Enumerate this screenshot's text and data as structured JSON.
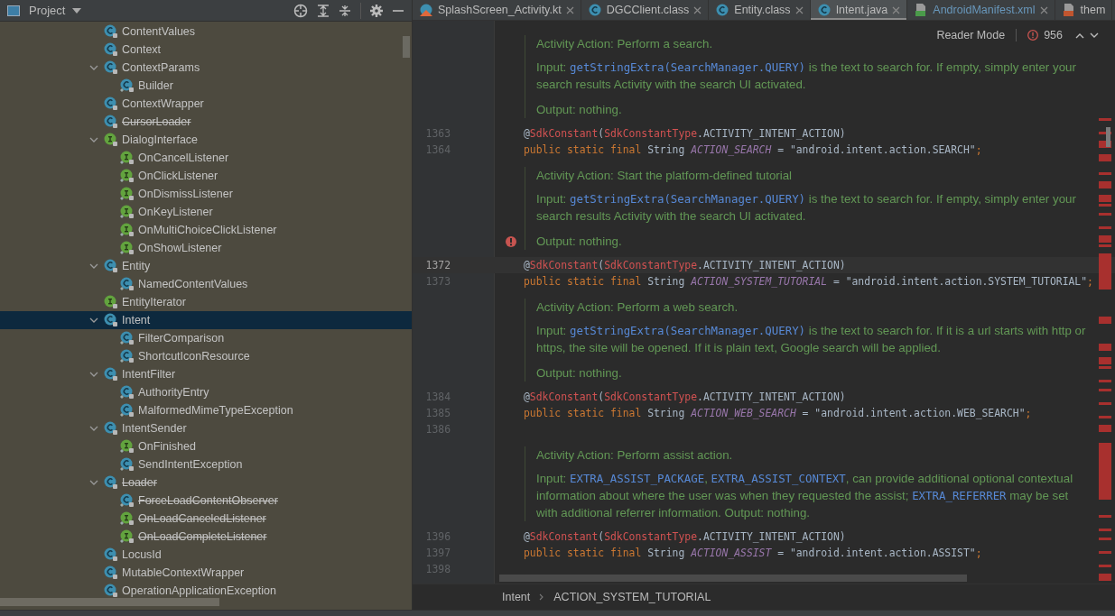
{
  "project_panel": {
    "title": "Project",
    "tree": [
      {
        "label": "ContentValues",
        "kind": "class",
        "deprecated": false,
        "selected": false,
        "expanded": false
      },
      {
        "label": "Context",
        "kind": "class",
        "deprecated": false,
        "selected": false,
        "expanded": false
      },
      {
        "label": "ContextParams",
        "kind": "class",
        "deprecated": false,
        "selected": false,
        "expanded": true,
        "children": [
          {
            "label": "Builder",
            "kind": "class",
            "deprecated": false,
            "selected": false,
            "expanded": false
          }
        ]
      },
      {
        "label": "ContextWrapper",
        "kind": "class",
        "deprecated": false,
        "selected": false,
        "expanded": false
      },
      {
        "label": "CursorLoader",
        "kind": "class",
        "deprecated": true,
        "selected": false,
        "expanded": false
      },
      {
        "label": "DialogInterface",
        "kind": "interface",
        "deprecated": false,
        "selected": false,
        "expanded": true,
        "children": [
          {
            "label": "OnCancelListener",
            "kind": "interface",
            "deprecated": false,
            "selected": false,
            "expanded": false
          },
          {
            "label": "OnClickListener",
            "kind": "interface",
            "deprecated": false,
            "selected": false,
            "expanded": false
          },
          {
            "label": "OnDismissListener",
            "kind": "interface",
            "deprecated": false,
            "selected": false,
            "expanded": false
          },
          {
            "label": "OnKeyListener",
            "kind": "interface",
            "deprecated": false,
            "selected": false,
            "expanded": false
          },
          {
            "label": "OnMultiChoiceClickListener",
            "kind": "interface",
            "deprecated": false,
            "selected": false,
            "expanded": false
          },
          {
            "label": "OnShowListener",
            "kind": "interface",
            "deprecated": false,
            "selected": false,
            "expanded": false
          }
        ]
      },
      {
        "label": "Entity",
        "kind": "class",
        "deprecated": false,
        "selected": false,
        "expanded": true,
        "children": [
          {
            "label": "NamedContentValues",
            "kind": "class",
            "deprecated": false,
            "selected": false,
            "expanded": false
          }
        ]
      },
      {
        "label": "EntityIterator",
        "kind": "interface",
        "deprecated": false,
        "selected": false,
        "expanded": false
      },
      {
        "label": "Intent",
        "kind": "class",
        "deprecated": false,
        "selected": true,
        "expanded": true,
        "children": [
          {
            "label": "FilterComparison",
            "kind": "class",
            "deprecated": false,
            "selected": false,
            "expanded": false
          },
          {
            "label": "ShortcutIconResource",
            "kind": "class",
            "deprecated": false,
            "selected": false,
            "expanded": false
          }
        ]
      },
      {
        "label": "IntentFilter",
        "kind": "class",
        "deprecated": false,
        "selected": false,
        "expanded": true,
        "children": [
          {
            "label": "AuthorityEntry",
            "kind": "class",
            "deprecated": false,
            "selected": false,
            "expanded": false
          },
          {
            "label": "MalformedMimeTypeException",
            "kind": "class",
            "deprecated": false,
            "selected": false,
            "expanded": false
          }
        ]
      },
      {
        "label": "IntentSender",
        "kind": "class",
        "deprecated": false,
        "selected": false,
        "expanded": true,
        "children": [
          {
            "label": "OnFinished",
            "kind": "interface",
            "deprecated": false,
            "selected": false,
            "expanded": false
          },
          {
            "label": "SendIntentException",
            "kind": "class",
            "deprecated": false,
            "selected": false,
            "expanded": false
          }
        ]
      },
      {
        "label": "Loader",
        "kind": "class",
        "deprecated": true,
        "selected": false,
        "expanded": true,
        "children": [
          {
            "label": "ForceLoadContentObserver",
            "kind": "class",
            "deprecated": true,
            "selected": false,
            "expanded": false
          },
          {
            "label": "OnLoadCanceledListener",
            "kind": "interface",
            "deprecated": true,
            "selected": false,
            "expanded": false
          },
          {
            "label": "OnLoadCompleteListener",
            "kind": "interface",
            "deprecated": true,
            "selected": false,
            "expanded": false
          }
        ]
      },
      {
        "label": "LocusId",
        "kind": "class",
        "deprecated": false,
        "selected": false,
        "expanded": false
      },
      {
        "label": "MutableContextWrapper",
        "kind": "class",
        "deprecated": false,
        "selected": false,
        "expanded": false
      },
      {
        "label": "OperationApplicationException",
        "kind": "class",
        "deprecated": false,
        "selected": false,
        "expanded": false
      }
    ]
  },
  "tabs": [
    {
      "label": "SplashScreen_Activity.kt",
      "kind": "kotlin",
      "selected": false,
      "closable": true,
      "color": "#bbbbbb"
    },
    {
      "label": "DGCClient.class",
      "kind": "class",
      "selected": false,
      "closable": true,
      "color": "#bbbbbb"
    },
    {
      "label": "Entity.class",
      "kind": "class",
      "selected": false,
      "closable": true,
      "color": "#bbbbbb"
    },
    {
      "label": "Intent.java",
      "kind": "class",
      "selected": true,
      "closable": true,
      "color": "#bbbbbb"
    },
    {
      "label": "AndroidManifest.xml",
      "kind": "manifest",
      "selected": false,
      "closable": true,
      "color": "#6897bb"
    },
    {
      "label": "them",
      "kind": "xml",
      "selected": false,
      "closable": false,
      "color": "#bbbbbb"
    }
  ],
  "reader_mode": {
    "label": "Reader Mode",
    "problems": "956"
  },
  "editor": [
    {
      "kind": "doc",
      "paragraphs": [
        [
          {
            "kind": "text",
            "text": "Activity Action: Perform a search."
          }
        ],
        [
          {
            "kind": "text",
            "text": "Input: "
          },
          {
            "kind": "link",
            "text": "getStringExtra(SearchManager.QUERY)"
          },
          {
            "kind": "text",
            "text": " is the text to search for. If empty, simply enter your search results Activity with the search UI activated."
          }
        ],
        [
          {
            "kind": "text",
            "text": "Output: nothing."
          }
        ]
      ]
    },
    {
      "kind": "code",
      "number": "1363",
      "current": false,
      "tokens": [
        {
          "kind": "plain",
          "t": "@"
        },
        {
          "kind": "annotation",
          "t": "SdkConstant"
        },
        {
          "kind": "plain",
          "t": "("
        },
        {
          "kind": "annotation",
          "t": "SdkConstantType"
        },
        {
          "kind": "plain",
          "t": ".ACTIVITY_INTENT_ACTION)"
        }
      ]
    },
    {
      "kind": "code",
      "number": "1364",
      "current": false,
      "tokens": [
        {
          "kind": "keyword",
          "t": "public static final "
        },
        {
          "kind": "plain",
          "t": "String "
        },
        {
          "kind": "field",
          "t": "ACTION_SEARCH"
        },
        {
          "kind": "plain",
          "t": " = "
        },
        {
          "kind": "string",
          "t": "\"android.intent.action.SEARCH\""
        },
        {
          "kind": "keyword",
          "t": ";"
        }
      ]
    },
    {
      "kind": "doc",
      "has_error": true,
      "paragraphs": [
        [
          {
            "kind": "text",
            "text": "Activity Action: Start the platform-defined tutorial"
          }
        ],
        [
          {
            "kind": "text",
            "text": "Input: "
          },
          {
            "kind": "link",
            "text": "getStringExtra(SearchManager.QUERY)"
          },
          {
            "kind": "text",
            "text": " is the text to search for. If empty, simply enter your search results Activity with the search UI activated."
          }
        ],
        [
          {
            "kind": "text",
            "text": "Output: nothing."
          }
        ]
      ]
    },
    {
      "kind": "code",
      "number": "1372",
      "current": true,
      "tokens": [
        {
          "kind": "plain",
          "t": "@"
        },
        {
          "kind": "annotation",
          "t": "SdkConstant"
        },
        {
          "kind": "plain",
          "t": "("
        },
        {
          "kind": "annotation",
          "t": "SdkConstantType"
        },
        {
          "kind": "plain",
          "t": ".ACTIVITY_INTENT_ACTION)"
        }
      ]
    },
    {
      "kind": "code",
      "number": "1373",
      "current": false,
      "tokens": [
        {
          "kind": "keyword",
          "t": "public static final "
        },
        {
          "kind": "plain",
          "t": "String "
        },
        {
          "kind": "field",
          "t": "ACTION_SYSTEM_TUTORIAL"
        },
        {
          "kind": "plain",
          "t": " = "
        },
        {
          "kind": "string",
          "t": "\"android.intent.action.SYSTEM_TUTORIAL\""
        },
        {
          "kind": "keyword",
          "t": ";"
        }
      ]
    },
    {
      "kind": "doc",
      "paragraphs": [
        [
          {
            "kind": "text",
            "text": "Activity Action: Perform a web search."
          }
        ],
        [
          {
            "kind": "text",
            "text": "Input: "
          },
          {
            "kind": "link",
            "text": "getStringExtra(SearchManager.QUERY)"
          },
          {
            "kind": "text",
            "text": " is the text to search for. If it is a url starts with http or https, the site will be opened. If it is plain text, Google search will be applied."
          }
        ],
        [
          {
            "kind": "text",
            "text": "Output: nothing."
          }
        ]
      ]
    },
    {
      "kind": "code",
      "number": "1384",
      "current": false,
      "tokens": [
        {
          "kind": "plain",
          "t": "@"
        },
        {
          "kind": "annotation",
          "t": "SdkConstant"
        },
        {
          "kind": "plain",
          "t": "("
        },
        {
          "kind": "annotation",
          "t": "SdkConstantType"
        },
        {
          "kind": "plain",
          "t": ".ACTIVITY_INTENT_ACTION)"
        }
      ]
    },
    {
      "kind": "code",
      "number": "1385",
      "current": false,
      "tokens": [
        {
          "kind": "keyword",
          "t": "public static final "
        },
        {
          "kind": "plain",
          "t": "String "
        },
        {
          "kind": "field",
          "t": "ACTION_WEB_SEARCH"
        },
        {
          "kind": "plain",
          "t": " = "
        },
        {
          "kind": "string",
          "t": "\"android.intent.action.WEB_SEARCH\""
        },
        {
          "kind": "keyword",
          "t": ";"
        }
      ]
    },
    {
      "kind": "code",
      "number": "1386",
      "current": false
    },
    {
      "kind": "doc",
      "paragraphs": [
        [
          {
            "kind": "text",
            "text": "Activity Action: Perform assist action."
          }
        ],
        [
          {
            "kind": "text",
            "text": "Input: "
          },
          {
            "kind": "link",
            "text": "EXTRA_ASSIST_PACKAGE"
          },
          {
            "kind": "text",
            "text": ", "
          },
          {
            "kind": "link",
            "text": "EXTRA_ASSIST_CONTEXT"
          },
          {
            "kind": "text",
            "text": ", can provide additional optional contextual information about where the user was when they requested the assist; "
          },
          {
            "kind": "link",
            "text": "EXTRA_REFERRER"
          },
          {
            "kind": "text",
            "text": " may be set with additional referrer information. Output: nothing."
          }
        ]
      ]
    },
    {
      "kind": "code",
      "number": "1396",
      "current": false,
      "tokens": [
        {
          "kind": "plain",
          "t": "@"
        },
        {
          "kind": "annotation",
          "t": "SdkConstant"
        },
        {
          "kind": "plain",
          "t": "("
        },
        {
          "kind": "annotation",
          "t": "SdkConstantType"
        },
        {
          "kind": "plain",
          "t": ".ACTIVITY_INTENT_ACTION)"
        }
      ]
    },
    {
      "kind": "code",
      "number": "1397",
      "current": false,
      "tokens": [
        {
          "kind": "keyword",
          "t": "public static final "
        },
        {
          "kind": "plain",
          "t": "String "
        },
        {
          "kind": "field",
          "t": "ACTION_ASSIST"
        },
        {
          "kind": "plain",
          "t": " = "
        },
        {
          "kind": "string",
          "t": "\"android.intent.action.ASSIST\""
        },
        {
          "kind": "keyword",
          "t": ";"
        }
      ]
    },
    {
      "kind": "code",
      "number": "1398",
      "current": false
    }
  ],
  "breadcrumbs": [
    "Intent",
    "ACTION_SYSTEM_TUTORIAL"
  ]
}
